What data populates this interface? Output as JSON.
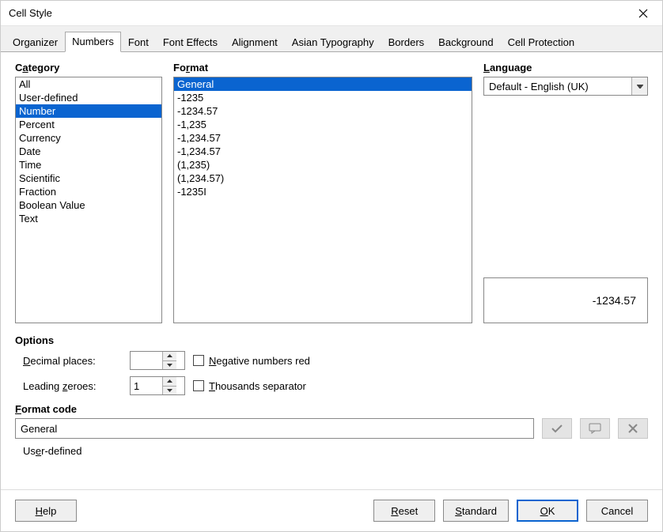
{
  "window": {
    "title": "Cell Style"
  },
  "tabs": [
    {
      "label": "Organizer"
    },
    {
      "label": "Numbers"
    },
    {
      "label": "Font"
    },
    {
      "label": "Font Effects"
    },
    {
      "label": "Alignment"
    },
    {
      "label": "Asian Typography"
    },
    {
      "label": "Borders"
    },
    {
      "label": "Background"
    },
    {
      "label": "Cell Protection"
    }
  ],
  "active_tab_index": 1,
  "headings": {
    "category_pre": "C",
    "category_u": "a",
    "category_post": "tegory",
    "format_pre": "Fo",
    "format_u": "r",
    "format_post": "mat",
    "language_pre": "",
    "language_u": "L",
    "language_post": "anguage",
    "options": "Options",
    "formatcode_pre": "",
    "formatcode_u": "F",
    "formatcode_post": "ormat code"
  },
  "category": {
    "selected_index": 2,
    "items": [
      "All",
      "User-defined",
      "Number",
      "Percent",
      "Currency",
      "Date",
      "Time",
      "Scientific",
      "Fraction",
      "Boolean Value",
      "Text"
    ]
  },
  "format": {
    "selected_index": 0,
    "items": [
      "General",
      "-1235",
      "-1234.57",
      "-1,235",
      "-1,234.57",
      "-1,234.57",
      "(1,235)",
      "(1,234.57)",
      "-1235I"
    ]
  },
  "language": {
    "value": "Default - English (UK)"
  },
  "preview": {
    "value": "-1234.57"
  },
  "options": {
    "decimal_label_pre": "",
    "decimal_label_u": "D",
    "decimal_label_post": "ecimal places:",
    "decimal_value": "",
    "leading_label_pre": "Leading ",
    "leading_label_u": "z",
    "leading_label_post": "eroes:",
    "leading_value": "1",
    "neg_pre": "",
    "neg_u": "N",
    "neg_post": "egative numbers red",
    "thou_pre": "",
    "thou_u": "T",
    "thou_post": "housands separator"
  },
  "format_code": {
    "value": "General"
  },
  "userdef_note_pre": "Us",
  "userdef_note_u": "e",
  "userdef_note_post": "r-defined",
  "buttons": {
    "help_pre": "",
    "help_u": "H",
    "help_post": "elp",
    "reset_pre": "",
    "reset_u": "R",
    "reset_post": "eset",
    "standard_pre": "",
    "standard_u": "S",
    "standard_post": "tandard",
    "ok_pre": "",
    "ok_u": "O",
    "ok_post": "K",
    "cancel": "Cancel"
  }
}
